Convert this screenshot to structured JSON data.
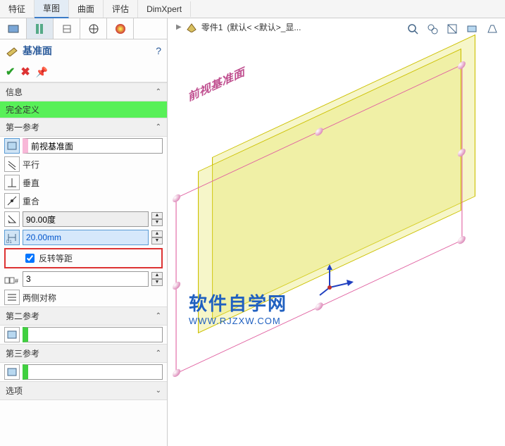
{
  "ribbon": {
    "tabs": [
      "特征",
      "草图",
      "曲面",
      "评估",
      "DimXpert"
    ],
    "active": 1
  },
  "breadcrumb": {
    "part": "零件1",
    "config": "(默认< <默认>_显..."
  },
  "feature": {
    "title": "基准面",
    "help": "?"
  },
  "info": {
    "header": "信息",
    "status": "完全定义"
  },
  "ref1": {
    "header": "第一参考",
    "face": "前视基准面",
    "parallel": "平行",
    "perpendicular": "垂直",
    "coincident": "重合",
    "angle": "90.00度",
    "distance": "20.00mm",
    "flip_label": "反转等距",
    "flip_checked": true,
    "count_label": "3",
    "symmetric": "两侧对称"
  },
  "ref2": {
    "header": "第二参考"
  },
  "ref3": {
    "header": "第三参考"
  },
  "options": {
    "header": "选项"
  },
  "viewport": {
    "plane_label": "前视基准面"
  },
  "watermark": {
    "line1": "软件自学网",
    "line2": "WWW.RJZXW.COM"
  },
  "icons": {
    "plane_feature": "plane-icon",
    "help": "help-icon",
    "accept": "check-icon",
    "reject": "x-icon",
    "pin": "pin-icon",
    "face": "face-icon",
    "parallel": "parallel-icon",
    "perp": "perpendicular-icon",
    "coincident": "coincident-icon",
    "angle": "angle-icon",
    "distance": "distance-icon",
    "instances": "instances-icon",
    "symmetric": "symmetric-icon",
    "zoom_fit": "zoom-fit-icon",
    "zoom_area": "zoom-area-icon",
    "section": "section-icon",
    "display": "display-style-icon",
    "perspective": "perspective-icon"
  }
}
